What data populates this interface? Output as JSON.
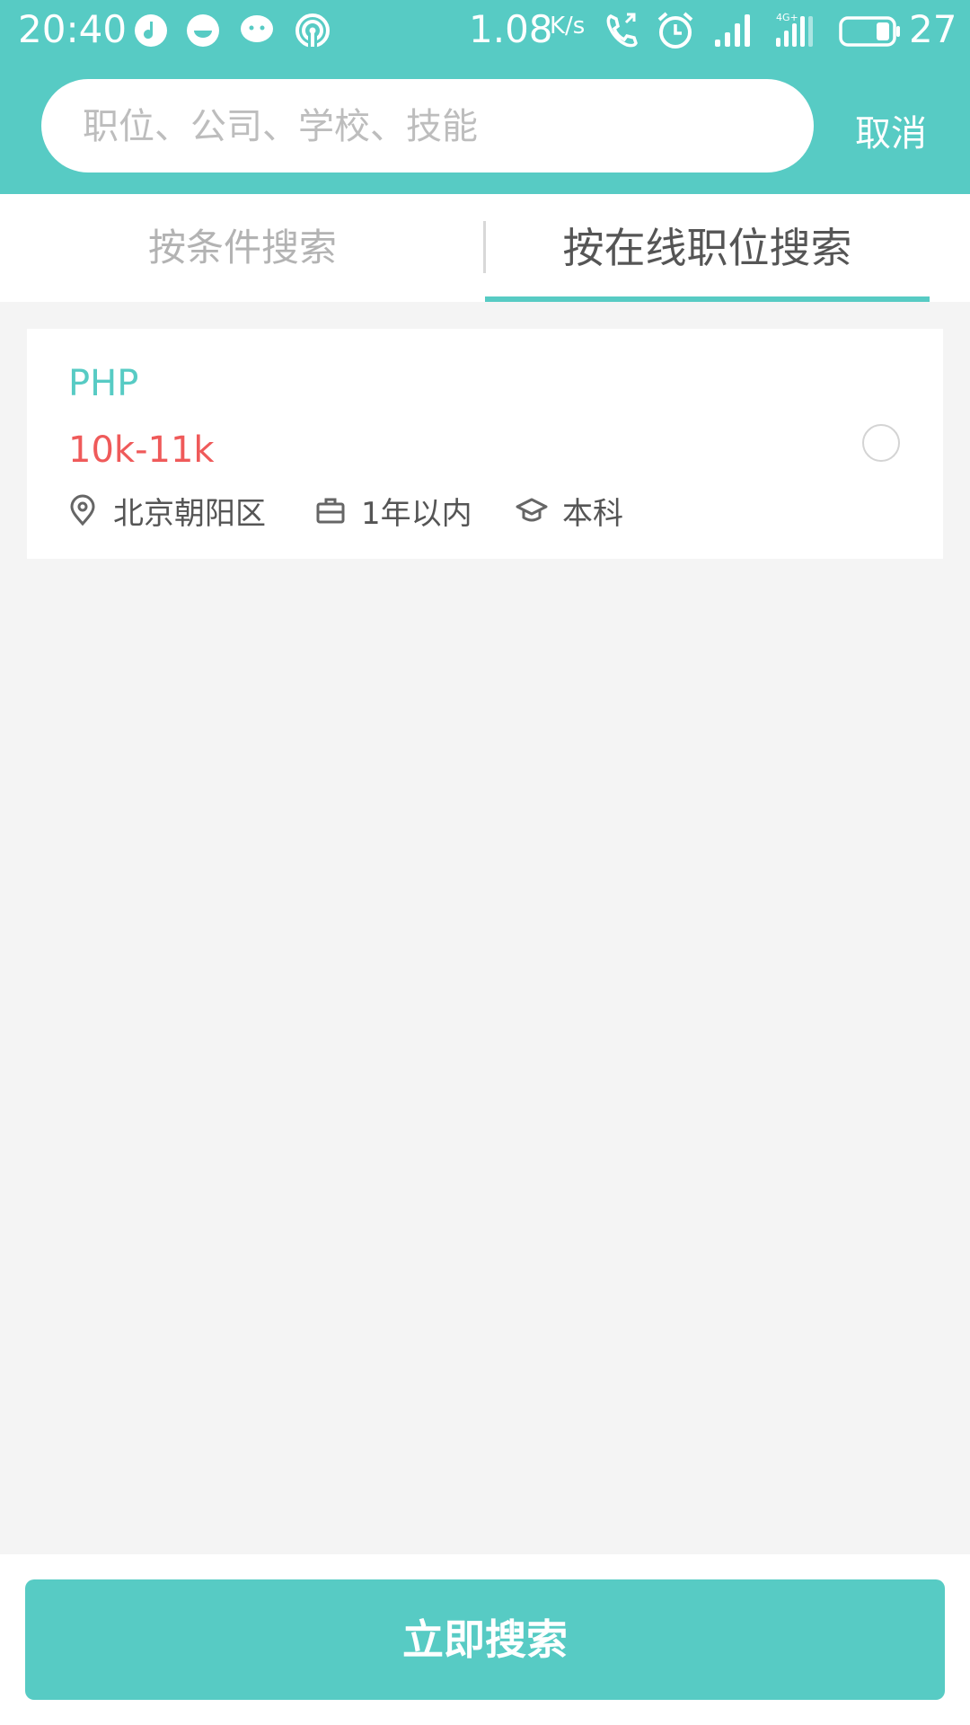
{
  "status_bar": {
    "time": "20:40",
    "network_speed": "1.08",
    "network_unit": "K/s",
    "network_type": "4G+",
    "battery": "27",
    "icons": [
      "music-app-icon",
      "chat-app-icon",
      "wechat-icon",
      "hotspot-icon",
      "call-icon",
      "alarm-icon",
      "signal-icon",
      "mobile-data-icon",
      "battery-icon"
    ]
  },
  "search": {
    "placeholder": "职位、公司、学校、技能",
    "value": "",
    "cancel_label": "取消"
  },
  "tabs": [
    {
      "label": "按条件搜索",
      "active": false
    },
    {
      "label": "按在线职位搜索",
      "active": true
    }
  ],
  "jobs": [
    {
      "title": "PHP",
      "salary": "10k-11k",
      "location": "北京朝阳区",
      "experience": "1年以内",
      "education": "本科",
      "selected": false
    }
  ],
  "action": {
    "search_label": "立即搜索"
  },
  "colors": {
    "accent": "#57cbc4",
    "salary": "#ef5a5a",
    "background": "#f4f4f4"
  }
}
